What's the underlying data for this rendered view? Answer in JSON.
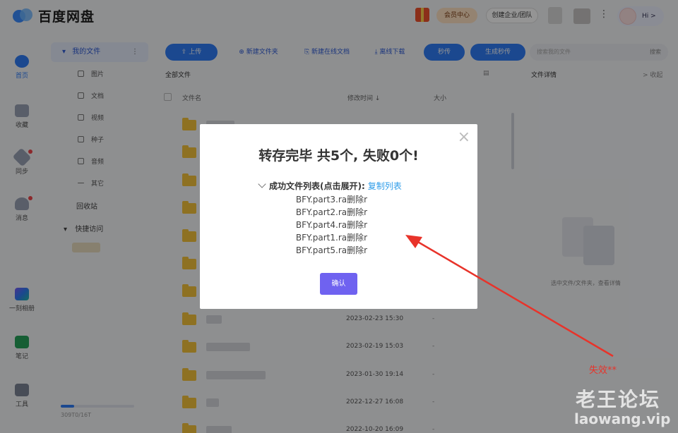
{
  "app": {
    "title": "百度网盘"
  },
  "header": {
    "vip_label": "会员中心",
    "biz_label": "创建企业/团队",
    "greeting": "Hi >",
    "more": "⋮"
  },
  "rail": [
    {
      "label": "首页",
      "icon": "cloud-icon"
    },
    {
      "label": "收藏",
      "icon": "bookmark-icon"
    },
    {
      "label": "同步",
      "icon": "sync-icon"
    },
    {
      "label": "消息",
      "icon": "people-icon"
    },
    {
      "label": "一刻相册",
      "icon": "album-icon"
    },
    {
      "label": "笔记",
      "icon": "note-icon"
    },
    {
      "label": "工具",
      "icon": "grid-icon"
    }
  ],
  "tree": {
    "root": "我的文件",
    "items": [
      "图片",
      "文档",
      "视频",
      "种子",
      "音频",
      "其它"
    ],
    "recycle": "回收站",
    "quick": "快捷访问",
    "storage_text": "309T0/16T",
    "storage_fraction": 0.18
  },
  "toolbar": {
    "upload": "上传",
    "new_folder": "新建文件夹",
    "new_doc": "新建在线文档",
    "offline": "离线下载",
    "instant": "秒传",
    "gen_instant": "生成秒传",
    "search_placeholder": "搜索我的文件",
    "search_btn": "搜索"
  },
  "breadcrumb": "全部文件",
  "detail": {
    "title": "文件详情",
    "collapse": "> 收起",
    "hint": "选中文件/文件夹，查看详情"
  },
  "table": {
    "headers": {
      "name": "文件名",
      "modified": "修改时间 ↓",
      "size": "大小"
    },
    "rows": [
      {
        "time": "",
        "size": ""
      },
      {
        "time": "",
        "size": ""
      },
      {
        "time": "",
        "size": ""
      },
      {
        "time": "",
        "size": ""
      },
      {
        "time": "",
        "size": ""
      },
      {
        "time": "",
        "size": ""
      },
      {
        "time": "",
        "size": ""
      },
      {
        "time": "2023-02-23 15:30",
        "size": "-"
      },
      {
        "time": "2023-02-19 15:03",
        "size": "-"
      },
      {
        "time": "2023-01-30 19:14",
        "size": "-"
      },
      {
        "time": "2022-12-27 16:08",
        "size": "-"
      },
      {
        "time": "2022-10-20 16:09",
        "size": "-"
      }
    ]
  },
  "dialog": {
    "title": "转存完毕 共5个, 失败0个!",
    "expand_label": "成功文件列表(点击展开):",
    "copy_link": "复制列表",
    "files": [
      "BFY.part3.ra删除r",
      "BFY.part2.ra删除r",
      "BFY.part4.ra删除r",
      "BFY.part1.ra删除r",
      "BFY.part5.ra删除r"
    ],
    "ok": "确认",
    "close": "×"
  },
  "annotation": {
    "label": "失效**",
    "color": "#e8332a"
  },
  "watermark": {
    "line1": "老王论坛",
    "line2": "laowang.vip"
  }
}
